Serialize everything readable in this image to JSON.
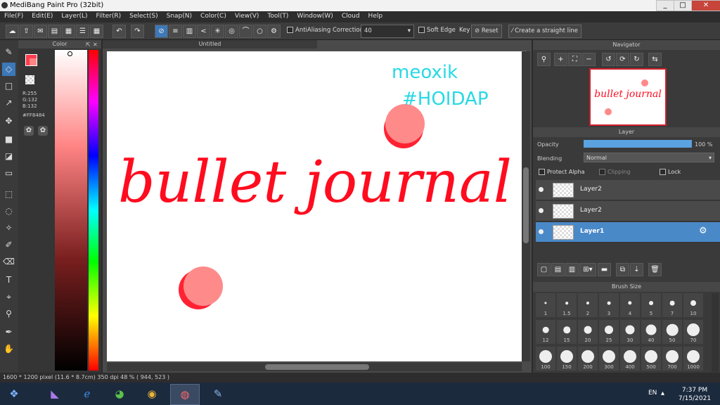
{
  "window": {
    "title": "MediBang Paint Pro (32bit)",
    "min_label": "_",
    "max_label": "□",
    "close_label": "✕"
  },
  "menu": [
    "File(F)",
    "Edit(E)",
    "Layer(L)",
    "Filter(R)",
    "Select(S)",
    "Snap(N)",
    "Color(C)",
    "View(V)",
    "Tool(T)",
    "Window(W)",
    "Cloud",
    "Help"
  ],
  "toolbar": {
    "antialiasing_label": "AntiAliasing",
    "correction_label": "Correction",
    "correction_value": "40",
    "soft_edge_label": "Soft Edge",
    "key_label": "Key",
    "reset_label": "Reset",
    "straight_line_label": "Create a straight line"
  },
  "color_panel": {
    "title": "Color",
    "r": "R:255",
    "g": "G:132",
    "b": "B:132",
    "hex": "#FF8484",
    "fg_color": "#ff3b4f",
    "bg_color": "#ff8484"
  },
  "document": {
    "tab_title": "Untitled"
  },
  "artwork": {
    "main_text": "bullet journal",
    "tag_line1": "meoxik",
    "tag_line2": "#HOIDAP",
    "text_color": "#ff0c1f",
    "tag_color": "#28d9e4",
    "dot_color": "#ff8a8a"
  },
  "navigator": {
    "title": "Navigator"
  },
  "layer_panel": {
    "title": "Layer",
    "opacity_label": "Opacity",
    "opacity_value": "100 %",
    "opacity_fraction": 1.0,
    "blending_label": "Blending",
    "blending_value": "Normal",
    "protect_alpha_label": "Protect Alpha",
    "clipping_label": "Clipping",
    "lock_label": "Lock",
    "layers": [
      {
        "name": "Layer2",
        "selected": false
      },
      {
        "name": "Layer2",
        "selected": false
      },
      {
        "name": "Layer1",
        "selected": true
      }
    ]
  },
  "brush_size": {
    "title": "Brush Size",
    "sizes": [
      "1",
      "1.5",
      "2",
      "3",
      "4",
      "5",
      "7",
      "10",
      "12",
      "15",
      "20",
      "25",
      "30",
      "40",
      "50",
      "70",
      "100",
      "150",
      "200",
      "300",
      "400",
      "500",
      "700",
      "1000"
    ]
  },
  "status": {
    "info": "1600 * 1200 pixel   (11.6 * 8.7cm)  350 dpi   48 %   ( 944, 523 )"
  },
  "taskbar": {
    "lang": "EN",
    "time": "7:37 PM",
    "date": "7/15/2021"
  }
}
